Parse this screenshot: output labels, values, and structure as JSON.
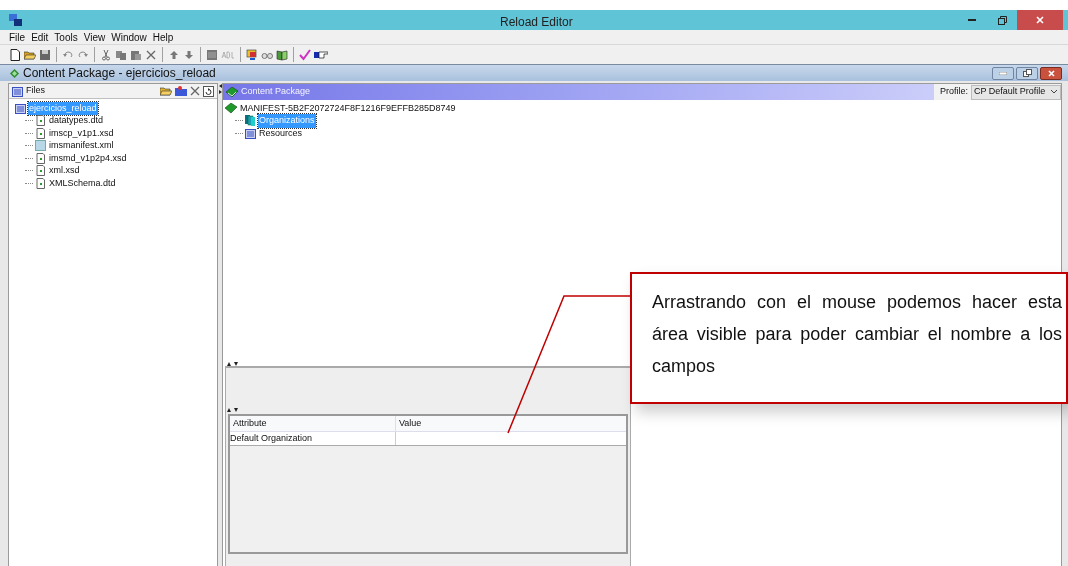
{
  "window": {
    "title": "Reload Editor"
  },
  "menu": [
    "File",
    "Edit",
    "Tools",
    "View",
    "Window",
    "Help"
  ],
  "inner_frame": {
    "title": "Content Package - ejercicios_reload"
  },
  "files_panel": {
    "title": "Files",
    "tree": {
      "label": "ejercicios_reload",
      "kind": "folder",
      "selected": true,
      "children": [
        {
          "label": "datatypes.dtd",
          "kind": "file",
          "selected": false
        },
        {
          "label": "imscp_v1p1.xsd",
          "kind": "file",
          "selected": false
        },
        {
          "label": "imsmanifest.xml",
          "kind": "manifest",
          "selected": false
        },
        {
          "label": "imsmd_v1p2p4.xsd",
          "kind": "file",
          "selected": false
        },
        {
          "label": "xml.xsd",
          "kind": "file",
          "selected": false
        },
        {
          "label": "XMLSchema.dtd",
          "kind": "file",
          "selected": false
        }
      ]
    }
  },
  "content_panel": {
    "title": "Content Package",
    "profile_label": "Profile:",
    "profile_value": "CP Default Profile",
    "tree": {
      "label": "MANIFEST-5B2F2072724F8F1216F9EFFB285D8749",
      "kind": "manifest",
      "selected": false,
      "children": [
        {
          "label": "Organizations",
          "kind": "organizations",
          "selected": true
        },
        {
          "label": "Resources",
          "kind": "resources",
          "selected": false
        }
      ]
    }
  },
  "attributes_table": {
    "columns": [
      "Attribute",
      "Value"
    ],
    "rows": [
      {
        "attribute": "Default Organization"
      }
    ]
  },
  "callout": {
    "text": "Arrastrando con el mouse podemos hacer esta área visible para poder cambiar el nombre a los campos"
  }
}
